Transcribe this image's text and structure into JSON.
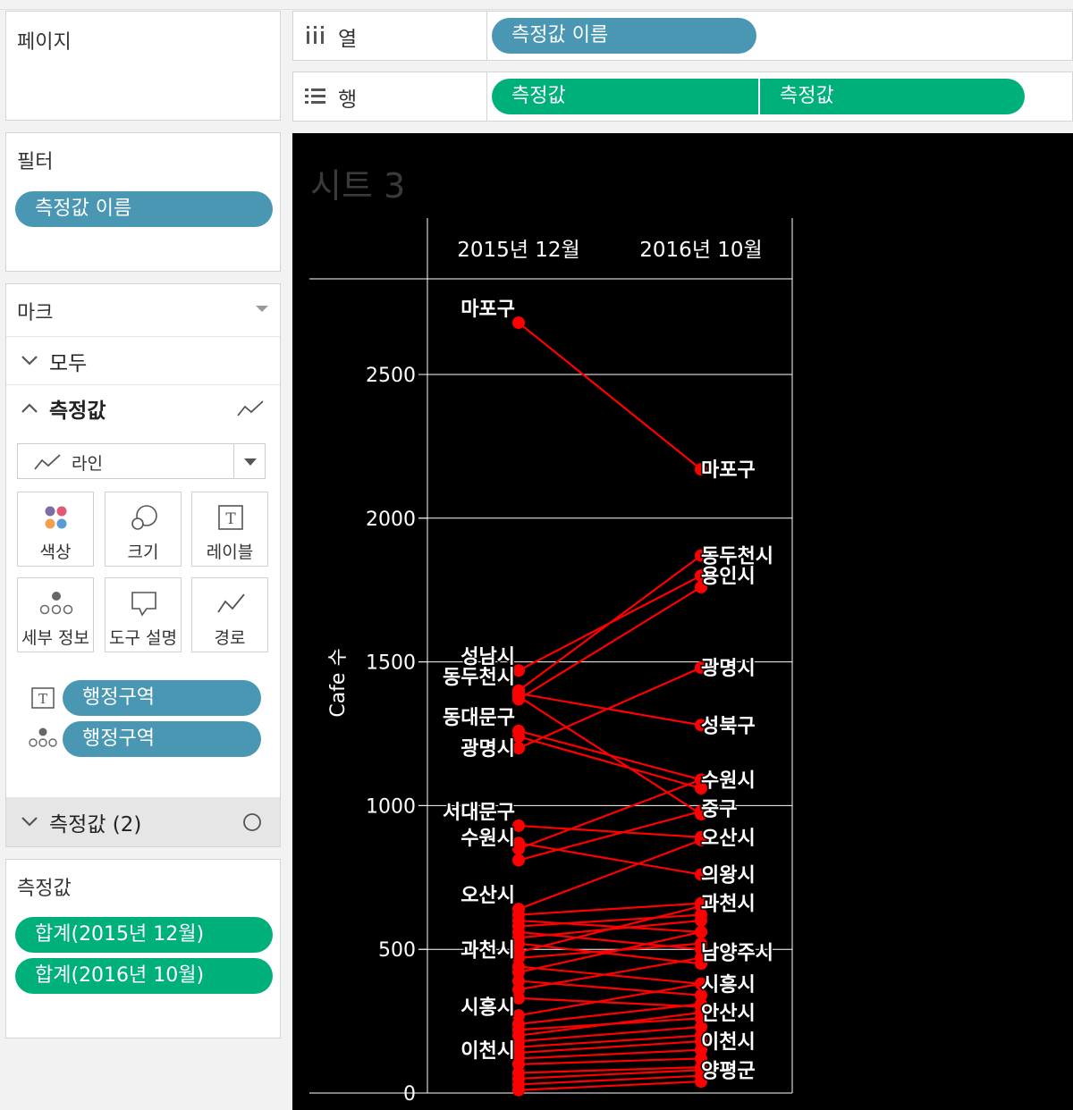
{
  "pages": {
    "title": "페이지"
  },
  "columns_shelf": {
    "icon": "columns-icon",
    "label": "열",
    "pills": [
      "측정값 이름"
    ]
  },
  "rows_shelf": {
    "icon": "rows-icon",
    "label": "행",
    "pills": [
      "측정값",
      "측정값"
    ]
  },
  "filters": {
    "title": "필터",
    "pills": [
      "측정값 이름"
    ]
  },
  "marks": {
    "title": "마크",
    "all_label": "모두",
    "measure_label": "측정값",
    "mark_type": "라인",
    "buttons": [
      "색상",
      "크기",
      "레이블",
      "세부 정보",
      "도구 설명",
      "경로"
    ],
    "label_pill": "행정구역",
    "detail_pill": "행정구역",
    "measure2_label": "측정값 (2)"
  },
  "measure_values": {
    "title": "측정값",
    "pills": [
      "합계(2015년 12월)",
      "합계(2016년 10월)"
    ]
  },
  "colors": {
    "blue_pill": "#4a97b4",
    "green_pill": "#00b07a",
    "line": "#ff0000",
    "background": "#000000"
  },
  "chart_data": {
    "type": "line",
    "title": "시트 3",
    "categories": [
      "2015년 12월",
      "2016년 10월"
    ],
    "ylabel": "Cafe 수",
    "ylim": [
      0,
      2800
    ],
    "yticks": [
      0,
      500,
      1000,
      1500,
      2000,
      2500
    ],
    "grid": true,
    "labels_left": [
      {
        "name": "마포구",
        "y": 2680
      },
      {
        "name": "성남시",
        "y": 1470
      },
      {
        "name": "동두천시",
        "y": 1400
      },
      {
        "name": "동대문구",
        "y": 1260
      },
      {
        "name": "광명시",
        "y": 1150
      },
      {
        "name": "서대문구",
        "y": 930
      },
      {
        "name": "수원시",
        "y": 840
      },
      {
        "name": "오산시",
        "y": 640
      },
      {
        "name": "과천시",
        "y": 450
      },
      {
        "name": "시흥시",
        "y": 250
      },
      {
        "name": "이천시",
        "y": 100
      }
    ],
    "labels_right": [
      {
        "name": "마포구",
        "y": 2170
      },
      {
        "name": "동두천시",
        "y": 1870
      },
      {
        "name": "용인시",
        "y": 1800
      },
      {
        "name": "광명시",
        "y": 1480
      },
      {
        "name": "성북구",
        "y": 1280
      },
      {
        "name": "수원시",
        "y": 1090
      },
      {
        "name": "중구",
        "y": 990
      },
      {
        "name": "오산시",
        "y": 890
      },
      {
        "name": "의왕시",
        "y": 760
      },
      {
        "name": "과천시",
        "y": 660
      },
      {
        "name": "남양주시",
        "y": 490
      },
      {
        "name": "시흥시",
        "y": 380
      },
      {
        "name": "안산시",
        "y": 280
      },
      {
        "name": "이천시",
        "y": 180
      },
      {
        "name": "양평군",
        "y": 80
      }
    ],
    "series": [
      {
        "name": "마포구",
        "values": [
          2680,
          2170
        ]
      },
      {
        "name": "성남시",
        "values": [
          1470,
          1800
        ]
      },
      {
        "name": "동두천시",
        "values": [
          1400,
          1870
        ]
      },
      {
        "name": "",
        "values": [
          1380,
          970
        ]
      },
      {
        "name": "",
        "values": [
          1370,
          1760
        ]
      },
      {
        "name": "",
        "values": [
          1390,
          1280
        ]
      },
      {
        "name": "동대문구",
        "values": [
          1260,
          1090
        ]
      },
      {
        "name": "",
        "values": [
          1240,
          1060
        ]
      },
      {
        "name": "광명시",
        "values": [
          1200,
          1480
        ]
      },
      {
        "name": "서대문구",
        "values": [
          930,
          890
        ]
      },
      {
        "name": "수원시",
        "values": [
          850,
          1090
        ]
      },
      {
        "name": "",
        "values": [
          810,
          980
        ]
      },
      {
        "name": "",
        "values": [
          870,
          760
        ]
      },
      {
        "name": "오산시",
        "values": [
          640,
          880
        ]
      },
      {
        "name": "",
        "values": [
          620,
          660
        ]
      },
      {
        "name": "",
        "values": [
          600,
          560
        ]
      },
      {
        "name": "",
        "values": [
          580,
          620
        ]
      },
      {
        "name": "",
        "values": [
          560,
          500
        ]
      },
      {
        "name": "",
        "values": [
          540,
          600
        ]
      },
      {
        "name": "",
        "values": [
          520,
          450
        ]
      },
      {
        "name": "과천시",
        "values": [
          490,
          650
        ]
      },
      {
        "name": "",
        "values": [
          470,
          520
        ]
      },
      {
        "name": "",
        "values": [
          440,
          380
        ]
      },
      {
        "name": "",
        "values": [
          420,
          560
        ]
      },
      {
        "name": "",
        "values": [
          390,
          340
        ]
      },
      {
        "name": "",
        "values": [
          360,
          470
        ]
      },
      {
        "name": "",
        "values": [
          330,
          300
        ]
      },
      {
        "name": "시흥시",
        "values": [
          270,
          380
        ]
      },
      {
        "name": "",
        "values": [
          240,
          310
        ]
      },
      {
        "name": "",
        "values": [
          220,
          260
        ]
      },
      {
        "name": "",
        "values": [
          200,
          280
        ]
      },
      {
        "name": "",
        "values": [
          180,
          230
        ]
      },
      {
        "name": "",
        "values": [
          160,
          200
        ]
      },
      {
        "name": "",
        "values": [
          140,
          180
        ]
      },
      {
        "name": "",
        "values": [
          120,
          150
        ]
      },
      {
        "name": "이천시",
        "values": [
          100,
          120
        ]
      },
      {
        "name": "",
        "values": [
          70,
          90
        ]
      },
      {
        "name": "",
        "values": [
          50,
          80
        ]
      },
      {
        "name": "",
        "values": [
          30,
          60
        ]
      },
      {
        "name": "",
        "values": [
          10,
          40
        ]
      }
    ]
  }
}
